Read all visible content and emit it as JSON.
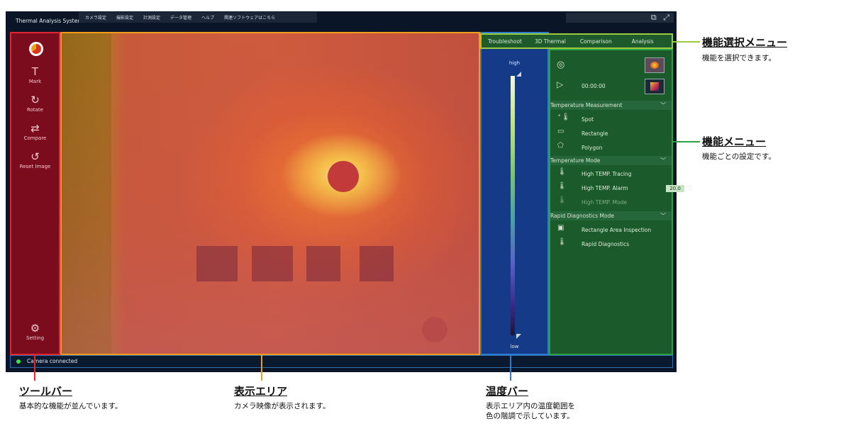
{
  "app": {
    "title": "Thermal Analysis Syster..",
    "menu": [
      "カメラ設定",
      "撮影設定",
      "計測設定",
      "データ管理",
      "ヘルプ",
      "関連ソフトウェアはこちら"
    ],
    "window_icons": [
      "restore-icon",
      "fullscreen-icon"
    ]
  },
  "toolbar": {
    "items": [
      {
        "label": "Mark",
        "icon": "text-cursor-icon",
        "glyph": "T"
      },
      {
        "label": "Rotate",
        "icon": "rotate-icon",
        "glyph": "↻"
      },
      {
        "label": "Compare",
        "icon": "compare-icon",
        "glyph": "⇄"
      },
      {
        "label": "Reset Image",
        "icon": "reset-icon",
        "glyph": "↺"
      }
    ],
    "setting_label": "Setting"
  },
  "tempbar": {
    "high": "high",
    "low": "low"
  },
  "function_tabs": [
    "Troubleshoot",
    "3D Thermal",
    "Comparison",
    "Analysis"
  ],
  "function_menu": {
    "timer": "00:00:00",
    "sections": [
      {
        "title": "Temperature Measurement",
        "items": [
          "Spot",
          "Rectangle",
          "Polygon"
        ]
      },
      {
        "title": "Temperature Mode",
        "items": [
          "High TEMP. Tracing",
          "High TEMP. Alarm",
          "High TEMP. Mode"
        ]
      },
      {
        "title": "Rapid Diagnostics Mode",
        "items": [
          "Rectangle Area Inspection",
          "Rapid Diagnostics"
        ]
      }
    ],
    "alarm_value": "20.0",
    "alarm_unit": "°C"
  },
  "status": {
    "text": "Camera connected",
    "color": "#3be24a"
  },
  "callouts": {
    "toolbar": {
      "title": "ツールバー",
      "desc": "基本的な機能が並んでいます。",
      "color": "#e3262d"
    },
    "display": {
      "title": "表示エリア",
      "desc": "カメラ映像が表示されます。",
      "color": "#f39c1a"
    },
    "tempbar": {
      "title": "温度バー",
      "desc1": "表示エリア内の温度範囲を",
      "desc2": "色の階調で示しています。",
      "color": "#2b7bd0"
    },
    "funcsel": {
      "title": "機能選択メニュー",
      "desc": "機能を選択できます。",
      "color": "#9ccc3c"
    },
    "funcmenu": {
      "title": "機能メニュー",
      "desc": "機能ごとの設定です。",
      "color": "#2ea043"
    }
  }
}
